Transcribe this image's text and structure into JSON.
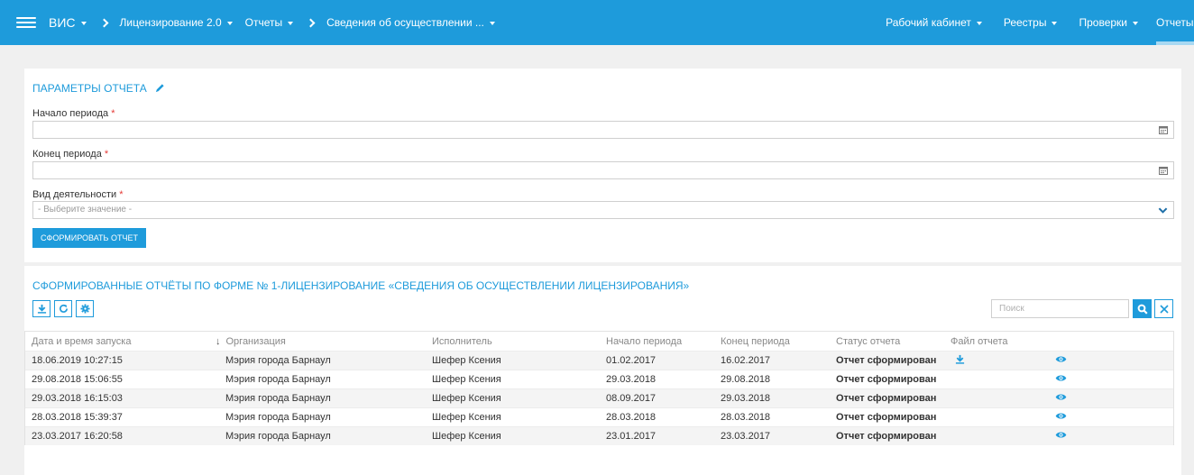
{
  "nav": {
    "app": "ВИС",
    "crumbs": [
      "Лицензирование 2.0",
      "Отчеты",
      "Сведения об осуществлении ..."
    ],
    "menu": [
      "Рабочий кабинет",
      "Реестры",
      "Проверки",
      "Отчеты"
    ]
  },
  "params": {
    "title": "ПАРАМЕТРЫ ОТЧЕТА",
    "start_label": "Начало периода",
    "end_label": "Конец периода",
    "activity_label": "Вид деятельности",
    "required_mark": "*",
    "activity_placeholder": "- Выберите значение -",
    "generate_button": "СФОРМИРОВАТЬ ОТЧЕТ"
  },
  "reports": {
    "title": "СФОРМИРОВАННЫЕ ОТЧЁТЫ ПО ФОРМЕ № 1-ЛИЦЕНЗИРОВАНИЕ «СВЕДЕНИЯ ОБ ОСУЩЕСТВЛЕНИИ ЛИЦЕНЗИРОВАНИЯ»",
    "search_placeholder": "Поиск",
    "sort_indicator": "↓",
    "columns": [
      "Дата и время запуска",
      "Организация",
      "Исполнитель",
      "Начало периода",
      "Конец периода",
      "Статус отчета",
      "Файл отчета"
    ],
    "rows": [
      {
        "date": "18.06.2019 10:27:15",
        "org": "Мэрия города Барнаул",
        "exec": "Шефер Ксения",
        "start": "01.02.2017",
        "end": "16.02.2017",
        "status": "Отчет сформирован",
        "has_file": true
      },
      {
        "date": "29.08.2018 15:06:55",
        "org": "Мэрия города Барнаул",
        "exec": "Шефер Ксения",
        "start": "29.03.2018",
        "end": "29.08.2018",
        "status": "Отчет сформирован",
        "has_file": false
      },
      {
        "date": "29.03.2018 16:15:03",
        "org": "Мэрия города Барнаул",
        "exec": "Шефер Ксения",
        "start": "08.09.2017",
        "end": "29.03.2018",
        "status": "Отчет сформирован",
        "has_file": false
      },
      {
        "date": "28.03.2018 15:39:37",
        "org": "Мэрия города Барнаул",
        "exec": "Шефер Ксения",
        "start": "28.03.2018",
        "end": "28.03.2018",
        "status": "Отчет сформирован",
        "has_file": false
      },
      {
        "date": "23.03.2017 16:20:58",
        "org": "Мэрия города Барнаул",
        "exec": "Шефер Ксения",
        "start": "23.01.2017",
        "end": "23.03.2017",
        "status": "Отчет сформирован",
        "has_file": false
      }
    ]
  },
  "colors": {
    "accent": "#1e9bdb",
    "required": "#e53935"
  },
  "icons": [
    "menu-icon",
    "chevron-right-icon",
    "pencil-icon",
    "calendar-icon",
    "chevron-down-icon",
    "download-icon",
    "refresh-icon",
    "gear-icon",
    "search-icon",
    "close-icon",
    "eye-icon"
  ]
}
